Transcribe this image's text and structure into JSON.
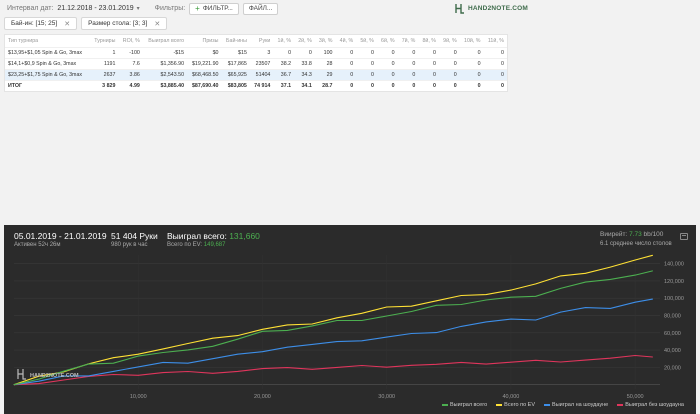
{
  "filters": {
    "interval_label": "Интервал дат:",
    "interval_value": "21.12.2018 - 23.01.2019",
    "filters_label": "Фильтры:",
    "filter_button": "ФИЛЬТР...",
    "file_button": "ФАЙЛ...",
    "logo_text": "HAND2NOTE.COM"
  },
  "chips": [
    {
      "label": "Бай-ин: [15; 25]"
    },
    {
      "label": "Размер стола: [3; 3]"
    }
  ],
  "table": {
    "headers": [
      "Тип турнира",
      "Турниры",
      "ROI, %",
      "Выиграл всего",
      "Призы",
      "Бай-ины",
      "Руки",
      "1й, %",
      "2й, %",
      "3й, %",
      "4й, %",
      "5й, %",
      "6й, %",
      "7й, %",
      "8й, %",
      "9й, %",
      "10й, %",
      "11й, %"
    ],
    "rows": [
      [
        "$13,95+$1,05 Spin & Go, 3max",
        "1",
        "-100",
        "-$15",
        "$0",
        "$15",
        "3",
        "0",
        "0",
        "100",
        "0",
        "0",
        "0",
        "0",
        "0",
        "0",
        "0",
        "0"
      ],
      [
        "$14,1+$0,9 Spin & Go, 3max",
        "1191",
        "7.6",
        "$1,356.90",
        "$19,221.90",
        "$17,865",
        "23507",
        "38.2",
        "33.8",
        "28",
        "0",
        "0",
        "0",
        "0",
        "0",
        "0",
        "0",
        "0"
      ],
      [
        "$23,25+$1,75 Spin & Go, 3max",
        "2637",
        "3.86",
        "$2,543.50",
        "$68,468.50",
        "$65,925",
        "51404",
        "36.7",
        "34.3",
        "29",
        "0",
        "0",
        "0",
        "0",
        "0",
        "0",
        "0",
        "0"
      ]
    ],
    "total": [
      "ИТОГ",
      "3 829",
      "4.99",
      "$3,885.40",
      "$87,690.40",
      "$83,805",
      "74 914",
      "37.1",
      "34.1",
      "28.7",
      "0",
      "0",
      "0",
      "0",
      "0",
      "0",
      "0",
      "0"
    ]
  },
  "graph": {
    "range": "05.01.2019 - 21.01.2019",
    "active": "Активен 52ч 26м",
    "hands": "51 404 Руки",
    "hands_rate": "980 рук в час",
    "won_label": "Выиграл всего:",
    "won_value": "131,660",
    "ev_label": "Всего по EV:",
    "ev_value": "149,687",
    "rake_label": "Виирейт:",
    "rake_value": "7.73",
    "rake_suffix": "bb/100",
    "tables_label": "6.1 среднее число столов",
    "watermark": "HAND2NOTE.COM"
  },
  "chart_data": {
    "type": "line",
    "xlabel": "",
    "ylabel": "",
    "xlim": [
      0,
      52000
    ],
    "ylim": [
      -5000,
      150000
    ],
    "x_ticks": [
      "10,000",
      "20,000",
      "30,000",
      "40,000",
      "50,000"
    ],
    "y_ticks": [
      "20,000",
      "40,000",
      "60,000",
      "80,000",
      "100,000",
      "120,000",
      "140,000"
    ],
    "x": [
      0,
      2000,
      4000,
      6000,
      8000,
      10000,
      12000,
      14000,
      16000,
      18000,
      20000,
      22000,
      24000,
      26000,
      28000,
      30000,
      32000,
      34000,
      36000,
      38000,
      40000,
      42000,
      44000,
      46000,
      48000,
      50000,
      51404
    ],
    "series": [
      {
        "name": "Выиграл всего",
        "color": "#4caf50",
        "values": [
          0,
          7000,
          15000,
          22000,
          26000,
          33000,
          36000,
          42000,
          45000,
          52000,
          60000,
          64000,
          68000,
          73000,
          76000,
          80000,
          84000,
          90000,
          94000,
          98000,
          100000,
          104000,
          112000,
          118000,
          120000,
          128000,
          131660
        ]
      },
      {
        "name": "Всего по EV",
        "color": "#ffe135",
        "values": [
          0,
          8000,
          16000,
          24000,
          30000,
          37000,
          42000,
          47000,
          52000,
          58000,
          64000,
          68000,
          72000,
          78000,
          82000,
          88000,
          92000,
          97000,
          102000,
          106000,
          110000,
          116000,
          124000,
          130000,
          136000,
          143000,
          149687
        ]
      },
      {
        "name": "Выиграл на шоудауне",
        "color": "#3d8ee8",
        "values": [
          0,
          4000,
          9000,
          12000,
          16000,
          20000,
          24000,
          26000,
          30000,
          34000,
          40000,
          44000,
          46000,
          48000,
          52000,
          55000,
          58000,
          62000,
          68000,
          72000,
          74000,
          76000,
          84000,
          88000,
          90000,
          96000,
          99000
        ]
      },
      {
        "name": "Выиграл без шоудауна",
        "color": "#e0355c",
        "values": [
          0,
          3000,
          6000,
          9000,
          10000,
          12000,
          14000,
          14000,
          15000,
          16000,
          18000,
          18000,
          19000,
          20000,
          21000,
          22000,
          23000,
          23000,
          24000,
          25000,
          26000,
          27000,
          28000,
          29000,
          30000,
          32000,
          32000
        ]
      }
    ],
    "legend_position": "bottom-right",
    "grid": true
  }
}
